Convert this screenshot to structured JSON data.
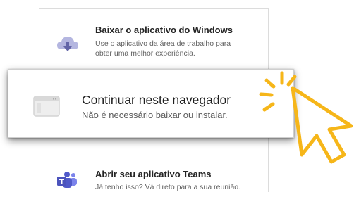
{
  "options": [
    {
      "title": "Baixar o aplicativo do Windows",
      "description_lines": [
        "Use o aplicativo da área de trabalho para",
        "obter uma melhor experiência."
      ],
      "icon": "cloud-download-icon"
    },
    {
      "title": "Continuar neste navegador",
      "description": "Não é necessário baixar ou instalar.",
      "icon": "browser-window-icon"
    },
    {
      "title": "Abrir seu aplicativo Teams",
      "description": "Já tenho isso? Vá direto para a sua reunião.",
      "icon": "teams-icon"
    }
  ],
  "cursor_icon": "hand-pointer-click-icon",
  "colors": {
    "accent": "#6264a7",
    "accent_light": "#b4b6e0",
    "cursor_yellow": "#f6b619",
    "title_text": "#242424",
    "description_text": "#616161"
  }
}
